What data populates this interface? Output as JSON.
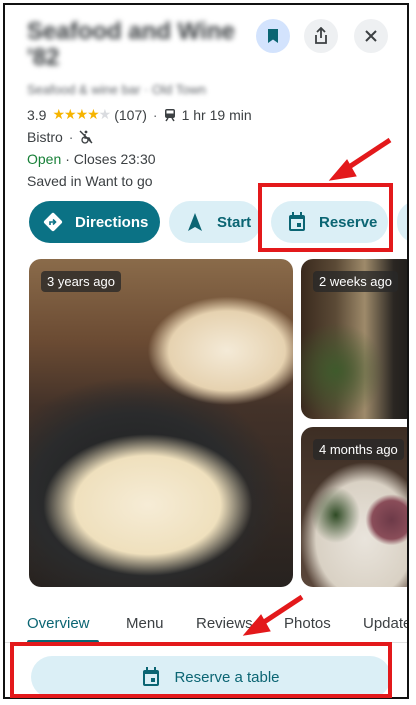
{
  "place": {
    "name": "Seafood and Wine '82",
    "subtitle": "Seafood & wine bar · Old Town",
    "rating": "3.9",
    "review_count": "(107)",
    "transit_time": "1 hr 19 min",
    "category": "Bistro",
    "status": "Open",
    "closes": "· Closes 23:30",
    "saved_in": "Saved in Want to go"
  },
  "actions": {
    "directions": "Directions",
    "start": "Start",
    "reserve": "Reserve"
  },
  "photos": {
    "main_age": "3 years ago",
    "top_right_age": "2 weeks ago",
    "bottom_right_age": "4 months ago"
  },
  "tabs": [
    "Overview",
    "Menu",
    "Reviews",
    "Photos",
    "Update"
  ],
  "bottom": {
    "reserve_table": "Reserve a table"
  },
  "colors": {
    "accent": "#0b7285",
    "tonal_button": "#dbeff6",
    "open_green": "#188038",
    "star": "#f6b400",
    "annotation_red": "#e3191b"
  },
  "icons": {
    "save": "bookmark-icon",
    "share": "share-icon",
    "close": "close-icon",
    "transit": "train-icon",
    "accessibility": "not-accessible-icon",
    "directions": "directions-icon",
    "start": "navigation-arrow-icon",
    "reserve": "calendar-icon"
  }
}
